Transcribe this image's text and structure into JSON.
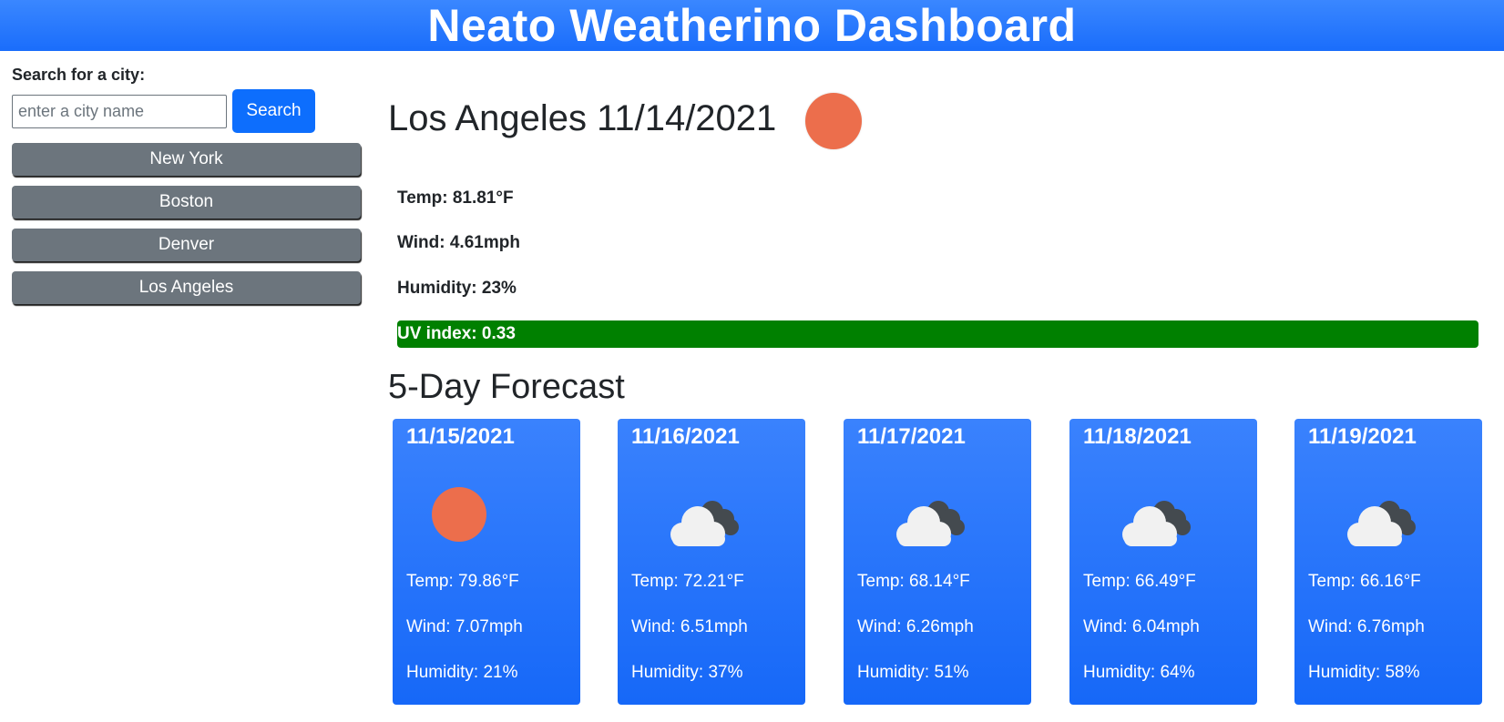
{
  "header": {
    "title": "Neato Weatherino Dashboard"
  },
  "search": {
    "label": "Search for a city:",
    "placeholder": "enter a city name",
    "value": "",
    "button_label": "Search"
  },
  "history": [
    "New York",
    "Boston",
    "Denver",
    "Los Angeles"
  ],
  "current": {
    "title": "Los Angeles 11/14/2021",
    "icon": "sun-icon",
    "temp": "Temp: 81.81°F",
    "wind": "Wind: 4.61mph",
    "humidity": "Humidity: 23%",
    "uv": "UV index: 0.33",
    "uv_color": "#008000"
  },
  "forecast": {
    "title": "5-Day Forecast",
    "days": [
      {
        "date": "11/15/2021",
        "icon": "sun-icon",
        "temp": "Temp: 79.86°F",
        "wind": "Wind: 7.07mph",
        "humidity": "Humidity: 21%"
      },
      {
        "date": "11/16/2021",
        "icon": "cloud-icon",
        "temp": "Temp: 72.21°F",
        "wind": "Wind: 6.51mph",
        "humidity": "Humidity: 37%"
      },
      {
        "date": "11/17/2021",
        "icon": "cloud-icon",
        "temp": "Temp: 68.14°F",
        "wind": "Wind: 6.26mph",
        "humidity": "Humidity: 51%"
      },
      {
        "date": "11/18/2021",
        "icon": "cloud-icon",
        "temp": "Temp: 66.49°F",
        "wind": "Wind: 6.04mph",
        "humidity": "Humidity: 64%"
      },
      {
        "date": "11/19/2021",
        "icon": "cloud-icon",
        "temp": "Temp: 66.16°F",
        "wind": "Wind: 6.76mph",
        "humidity": "Humidity: 58%"
      }
    ]
  },
  "colors": {
    "header": "#1a6dfb",
    "search_button": "#0d6efd",
    "history_button": "#6c757d",
    "card": "#2474fb",
    "sun": "#ec6e4c"
  }
}
